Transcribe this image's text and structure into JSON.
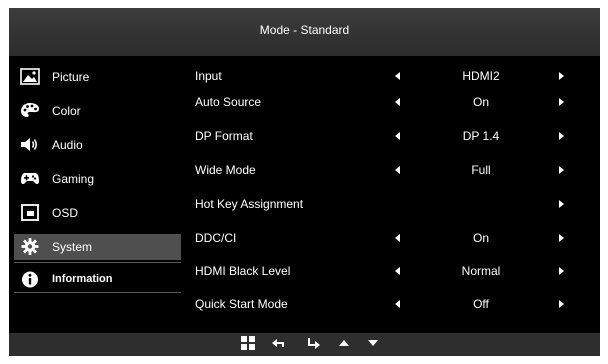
{
  "osd": {
    "title": "Mode - Standard"
  },
  "sidebar": {
    "items": [
      {
        "label": "Picture",
        "icon": "picture-icon"
      },
      {
        "label": "Color",
        "icon": "palette-icon"
      },
      {
        "label": "Audio",
        "icon": "speaker-icon"
      },
      {
        "label": "Gaming",
        "icon": "gamepad-icon"
      },
      {
        "label": "OSD",
        "icon": "osd-icon"
      },
      {
        "label": "System",
        "icon": "gear-icon",
        "selected": true
      },
      {
        "label": "Information",
        "icon": "info-icon"
      }
    ]
  },
  "settings": [
    {
      "label": "Input",
      "value": "HDMI2"
    },
    {
      "label": "Auto Source",
      "value": "On"
    },
    {
      "label": "DP Format",
      "value": "DP 1.4"
    },
    {
      "label": "Wide Mode",
      "value": "Full"
    },
    {
      "label": "Hot Key Assignment",
      "value": ""
    },
    {
      "label": "DDC/CI",
      "value": "On"
    },
    {
      "label": "HDMI Black Level",
      "value": "Normal"
    },
    {
      "label": "Quick Start Mode",
      "value": "Off"
    }
  ],
  "bottom_nav": [
    {
      "icon": "menu-grid-icon"
    },
    {
      "icon": "back-icon"
    },
    {
      "icon": "enter-icon"
    },
    {
      "icon": "up-arrow-icon"
    },
    {
      "icon": "down-arrow-icon"
    }
  ],
  "colors": {
    "background": "#000000",
    "title_bar": "#333333",
    "selected": "#4f4f4f",
    "text": "#ffffff"
  }
}
